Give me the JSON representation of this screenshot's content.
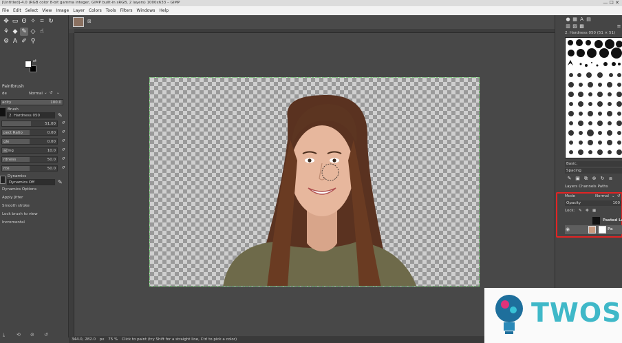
{
  "window": {
    "title": "[Untitled]-4.0 (RGB color 8-bit gamma integer, GIMP built-in sRGB, 2 layers) 1000x633 – GIMP",
    "controls": "— ☐ ✕"
  },
  "menu": [
    "File",
    "Edit",
    "Select",
    "View",
    "Image",
    "Layer",
    "Colors",
    "Tools",
    "Filters",
    "Windows",
    "Help"
  ],
  "toolbox": {
    "icons": [
      "move-icon",
      "rect-select-icon",
      "lasso-icon",
      "fuzzy-select-icon",
      "crop-icon",
      "rotate-icon",
      "warp-icon",
      "cage-icon",
      "paint-bucket-icon",
      "paintbrush-icon",
      "eraser-icon",
      "smudge-icon",
      "text-icon",
      "color-picker-icon",
      "zoom-icon"
    ]
  },
  "tool_options": {
    "title": "Paintbrush",
    "mode_label": "de",
    "mode_value": "Normal",
    "opacity_label": "acity",
    "opacity_value": "100.0",
    "brush_label": "Brush",
    "brush_value": "2. Hardness 050",
    "sliders": [
      {
        "label": "",
        "value": "51.00",
        "pct": 0.52
      },
      {
        "label": "pect Ratio",
        "value": "0.00",
        "pct": 0.5
      },
      {
        "label": "gle",
        "value": "0.00",
        "pct": 0.5
      },
      {
        "label": "acing",
        "value": "10.0",
        "pct": 0.1
      },
      {
        "label": "rdness",
        "value": "50.0",
        "pct": 0.5
      },
      {
        "label": "rce",
        "value": "50.0",
        "pct": 0.5
      }
    ],
    "dynamics_label": "Dynamics",
    "dynamics_value": "Dynamics Off",
    "checks": [
      "Dynamics Options",
      "Apply Jitter",
      "Smooth stroke",
      "Lock brush to view",
      "Incremental"
    ]
  },
  "status": {
    "coords": "344.0, 282.0",
    "unit": "px",
    "zoom": "75 %",
    "message": "Click to paint (try Shift for a straight line, Ctrl to pick a color)"
  },
  "brushes": {
    "header": "2. Hardness 050 (51 × 51)",
    "tag": "Basic,",
    "spacing_label": "Spacing"
  },
  "layers": {
    "tabs": [
      "Layers",
      "Channels",
      "Paths"
    ],
    "mode_label": "Mode",
    "mode_value": "Normal",
    "opacity_label": "Opacity",
    "opacity_value": "100",
    "lock_label": "Lock:",
    "items": [
      {
        "name": "Pasted La",
        "visible": false
      },
      {
        "name": "Pa",
        "visible": true
      }
    ]
  },
  "watermark": {
    "text": "TWOS"
  },
  "colors": {
    "accent_red": "#e22424",
    "watermark": "#3fb8c8",
    "selection": "#7fd07f"
  }
}
